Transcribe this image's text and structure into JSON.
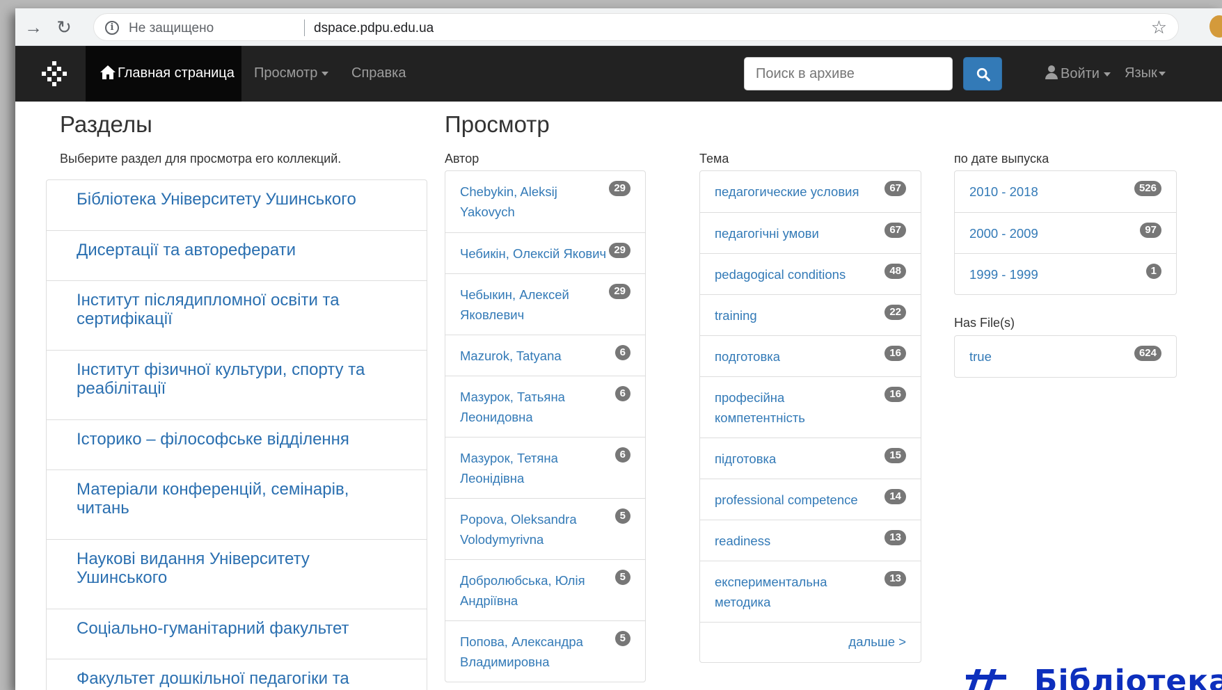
{
  "browser": {
    "security_label": "Не защищено",
    "url": "dspace.pdpu.edu.ua"
  },
  "navbar": {
    "home": "Главная страница",
    "browse": "Просмотр",
    "help": "Справка",
    "search_placeholder": "Поиск в архиве",
    "login": "Войти",
    "language": "Язык"
  },
  "sections": {
    "title": "Разделы",
    "description": "Выберите раздел для просмотра его коллекций.",
    "items": [
      "Бібліотека Університету Ушинського",
      "Дисертації та автореферати",
      "Інститут післядипломної освіти та сертифікації",
      "Інститут фізичної культури, спорту та реабілітації",
      "Історико – філософське відділення",
      "Матеріали конференцій, семінарів, читань",
      "Наукові видання Університету Ушинського",
      "Соціально-гуманітарний факультет",
      "Факультет дошкільної педагогіки та"
    ]
  },
  "browse": {
    "title": "Просмотр",
    "author": {
      "label": "Автор",
      "items": [
        {
          "name": "Chebykin, Aleksij Yakovych",
          "count": "29"
        },
        {
          "name": "Чебикін, Олексій Якович",
          "count": "29"
        },
        {
          "name": "Чебыкин, Алексей Яковлевич",
          "count": "29"
        },
        {
          "name": "Mazurok, Tatyana",
          "count": "6"
        },
        {
          "name": "Мазурок, Татьяна Леонидовна",
          "count": "6"
        },
        {
          "name": "Мазурок, Тетяна Леонідівна",
          "count": "6"
        },
        {
          "name": "Popova, Oleksandra Volodymyrivna",
          "count": "5"
        },
        {
          "name": "Добролюбська, Юлія Андріївна",
          "count": "5"
        },
        {
          "name": "Попова, Александра Владимировна",
          "count": "5"
        }
      ]
    },
    "subject": {
      "label": "Тема",
      "items": [
        {
          "name": "педагогические условия",
          "count": "67"
        },
        {
          "name": "педагогічні умови",
          "count": "67"
        },
        {
          "name": "pedagogical conditions",
          "count": "48"
        },
        {
          "name": "training",
          "count": "22"
        },
        {
          "name": "подготовка",
          "count": "16"
        },
        {
          "name": "професійна компетентність",
          "count": "16"
        },
        {
          "name": "підготовка",
          "count": "15"
        },
        {
          "name": "professional competence",
          "count": "14"
        },
        {
          "name": "readiness",
          "count": "13"
        },
        {
          "name": "експериментальна методика",
          "count": "13"
        }
      ],
      "more": "дальше >"
    },
    "date": {
      "label": "по дате выпуска",
      "items": [
        {
          "name": "2010 - 2018",
          "count": "526"
        },
        {
          "name": "2000 - 2009",
          "count": "97"
        },
        {
          "name": "1999 - 1999",
          "count": "1"
        }
      ]
    },
    "hasfile": {
      "label": "Has File(s)",
      "items": [
        {
          "name": "true",
          "count": "624"
        }
      ]
    }
  },
  "watermark": "Бібліотека"
}
